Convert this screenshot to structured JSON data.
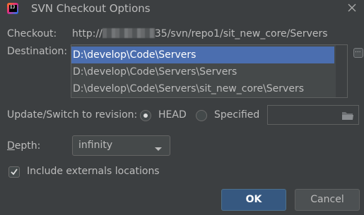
{
  "window": {
    "title": "SVN Checkout Options",
    "app_icon": "intellij-icon",
    "app_icon_text": "IJ"
  },
  "checkout": {
    "label": "Checkout:",
    "url_prefix": "http://",
    "url_suffix": "35/svn/repo1/sit_new_core/Servers"
  },
  "destination": {
    "label": "Destination:",
    "options": [
      "D:\\develop\\Code\\Servers",
      "D:\\develop\\Code\\Servers\\Servers",
      "D:\\develop\\Code\\Servers\\sit_new_core\\Servers"
    ],
    "selected_index": 0,
    "browse_label": "..."
  },
  "revision": {
    "label": "Update/Switch to revision:",
    "head_label": "HEAD",
    "specified_label": "Specified",
    "selected": "HEAD",
    "specified_value": ""
  },
  "depth": {
    "label_prefix": "",
    "label_mnemonic": "D",
    "label_rest": "epth:",
    "value": "infinity"
  },
  "externals": {
    "label": "Include externals locations",
    "checked": true
  },
  "buttons": {
    "ok": "OK",
    "cancel": "Cancel"
  },
  "colors": {
    "background": "#3c3f41",
    "selection": "#4b6eaf",
    "default_button": "#365880"
  }
}
